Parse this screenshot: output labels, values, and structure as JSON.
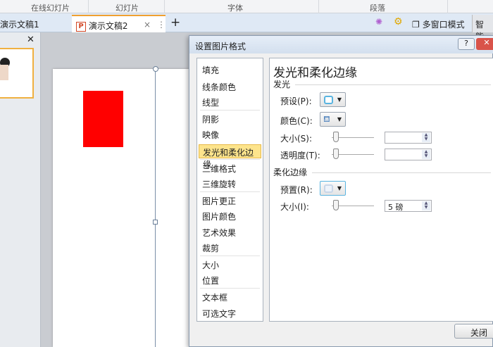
{
  "ribbon": {
    "groups": [
      "在线幻灯片",
      "幻灯片",
      "字体",
      "段落"
    ]
  },
  "tabs": {
    "items": [
      {
        "label": "演示文稿1"
      },
      {
        "label": "演示文稿2",
        "close": "×"
      }
    ],
    "add": "+",
    "multiwindow": "多窗口模式",
    "smart": "智能"
  },
  "leftpanel": {
    "close": "✕"
  },
  "dialog": {
    "title": "设置图片格式",
    "help": "?",
    "close_x": "✕",
    "nav": [
      "填充",
      "线条颜色",
      "线型",
      "阴影",
      "映像",
      "发光和柔化边缘",
      "三维格式",
      "三维旋转",
      "图片更正",
      "图片颜色",
      "艺术效果",
      "裁剪",
      "大小",
      "位置",
      "文本框",
      "可选文字"
    ],
    "selected_index": 5,
    "pane": {
      "heading": "发光和柔化边缘",
      "glow": {
        "title": "发光",
        "preset": "预设(P):",
        "color": "颜色(C):",
        "size": "大小(S):",
        "transparency": "透明度(T):",
        "size_value": "",
        "transparency_value": ""
      },
      "soft": {
        "title": "柔化边缘",
        "preset": "预置(R):",
        "size": "大小(I):",
        "size_value": "5 磅"
      }
    },
    "close_button": "关闭"
  },
  "colors": {
    "accent": "#fde48c",
    "shape": "#ff0000"
  }
}
